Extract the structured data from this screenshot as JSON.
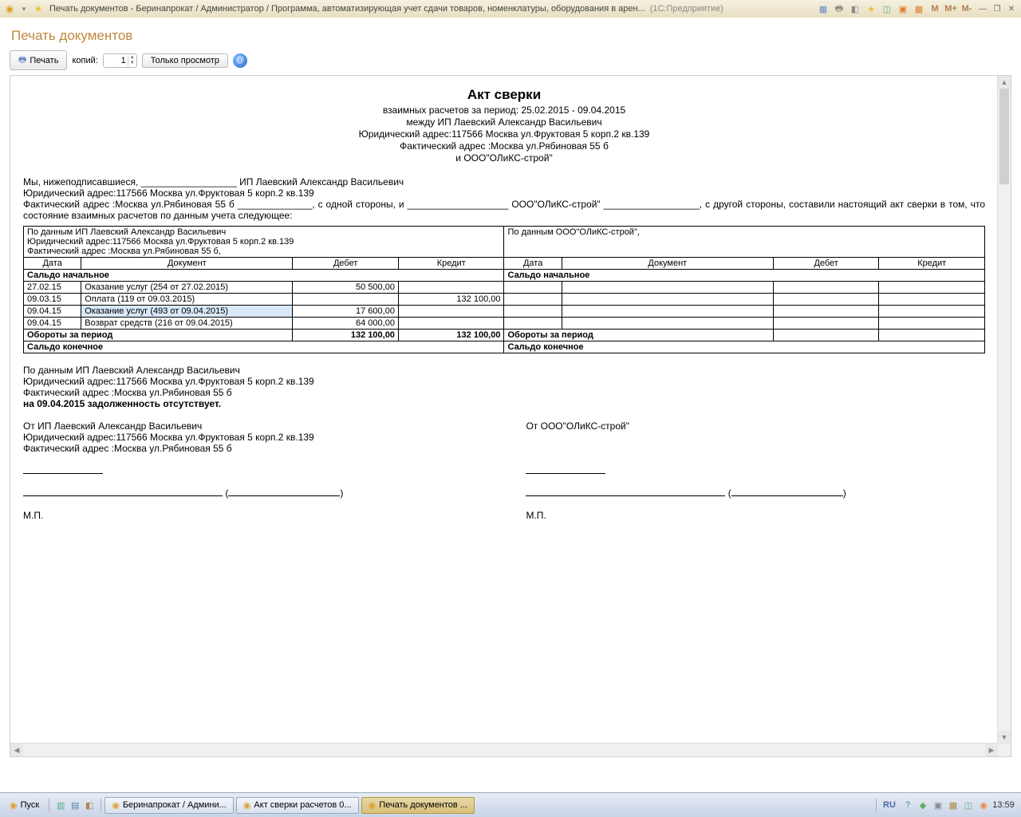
{
  "window": {
    "title": "Печать документов - Беринапрокат / Администратор / Программа, автоматизирующая учет сдачи товаров, номенклатуры, оборудования в арен...",
    "mode": "(1С:Предприятие)",
    "mbtns": {
      "m": "M",
      "mplus": "M+",
      "mminus": "M-"
    }
  },
  "page": {
    "title": "Печать документов",
    "toolbar": {
      "print": "Печать",
      "copies_label": "копий:",
      "copies_value": "1",
      "preview": "Только просмотр"
    }
  },
  "doc": {
    "title": "Акт сверки",
    "h1": "взаимных расчетов за период: 25.02.2015 - 09.04.2015",
    "h2": "между ИП Лаевский Александр Васильевич",
    "h3": "Юридический адрес:117566 Москва ул.Фруктовая 5 корп.2 кв.139",
    "h4": "Фактический адрес :Москва ул.Рябиновая 55 б",
    "h5": "и ООО\"ОЛиКС-строй\"",
    "para1a": "Мы, нижеподписавшиеся, __________________ ИП Лаевский Александр Васильевич",
    "para1b": "Юридический адрес:117566 Москва ул.Фруктовая 5 корп.2 кв.139",
    "para1c": "Фактический   адрес   :Москва   ул.Рябиновая   55   б   ______________,   с   одной   стороны,   и   ___________________   ООО\"ОЛиКС-строй\" __________________, с другой стороны, составили настоящий акт сверки в том, что состояние взаимных расчетов по данным учета следующее:",
    "left_header": "По данным ИП Лаевский Александр Васильевич",
    "left_addr1": "Юридический адрес:117566 Москва ул.Фруктовая 5 корп.2 кв.139",
    "left_addr2": "Фактический адрес :Москва ул.Рябиновая 55 б,",
    "right_header": "По данным ООО\"ОЛиКС-строй\",",
    "cols": {
      "date": "Дата",
      "doc": "Документ",
      "debit": "Дебет",
      "credit": "Кредит"
    },
    "saldo_start": "Сальдо начальное",
    "rows": [
      {
        "date": "27.02.15",
        "doc": "Оказание услуг (254 от 27.02.2015)",
        "debit": "50 500,00",
        "credit": ""
      },
      {
        "date": "09.03.15",
        "doc": "Оплата (119 от 09.03.2015)",
        "debit": "",
        "credit": "132 100,00"
      },
      {
        "date": "09.04.15",
        "doc": "Оказание услуг (493 от 09.04.2015)",
        "debit": "17 600,00",
        "credit": "",
        "sel": true
      },
      {
        "date": "09.04.15",
        "doc": "Возврат средств (216 от 09.04.2015)",
        "debit": "64 000,00",
        "credit": ""
      }
    ],
    "turnover": "Обороты за период",
    "turnover_debit": "132 100,00",
    "turnover_credit": "132 100,00",
    "saldo_end": "Сальдо конечное",
    "summary1": "По данным ИП Лаевский Александр Васильевич",
    "summary2": "Юридический адрес:117566 Москва ул.Фруктовая 5 корп.2 кв.139",
    "summary3": "Фактический адрес :Москва ул.Рябиновая 55 б",
    "summary4": "на 09.04.2015 задолженность отсутствует.",
    "sig_from_left": "От ИП Лаевский Александр Васильевич",
    "sig_addr1": "Юридический адрес:117566 Москва ул.Фруктовая 5 корп.2 кв.139",
    "sig_addr2": "Фактический адрес :Москва ул.Рябиновая 55 б",
    "sig_from_right": "От ООО\"ОЛиКС-строй\"",
    "mp": "М.П."
  },
  "taskbar": {
    "start": "Пуск",
    "buttons": [
      {
        "label": "Беринапрокат / Админи...",
        "active": false
      },
      {
        "label": "Акт сверки расчетов 0...",
        "active": false
      },
      {
        "label": "Печать документов ...",
        "active": true
      }
    ],
    "lang": "RU",
    "clock": "13:59"
  }
}
